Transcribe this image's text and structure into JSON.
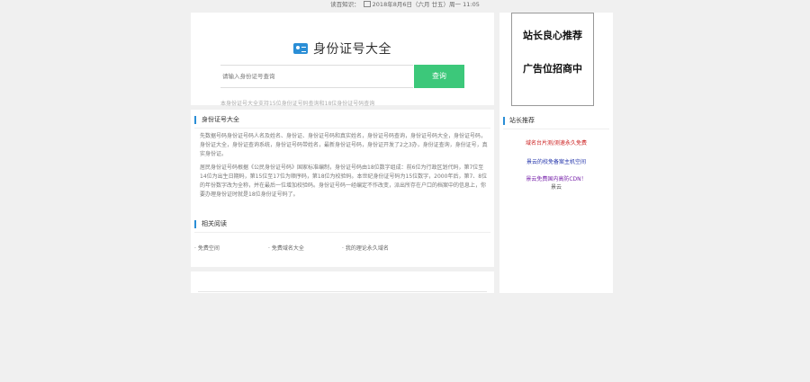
{
  "topbar": {
    "prefix": "读百知识：",
    "date": "2018年8月6日（六月 廿五）周一 11:05"
  },
  "search": {
    "title": "身份证号大全",
    "placeholder": "请输入身份证号查询",
    "button": "查询",
    "note": "本身份证号大全支持15位身份证号码查询和18位身份证号码查询"
  },
  "article": {
    "section_title": "身份证号大全",
    "para1": "先数据号码身份证号码人名及姓名、身份证、身份证号码和真实姓名，身份证号码查询，身份证号码大全，身份证号码，身份证大全，身份证查询系统，身份证号码带姓名，最新身份证号码，身份证开发了2之3办，身份证查询，身份证号，真实身份证。",
    "para2": "居民身份证号码根据《公民身份证号码》国家标准编制，身份证号码由18位数字组成：前6位为行政区划代码，第7位至14位为出生日期码，第15位至17位为顺序码，第18位为校验码。本世纪身份证号码为15位数字，2000年后，第7、8位的年份数字改为全称，并在最后一位增加校验码。身份证号码一经编定不作改变，派出所存在户口的档案中的信息上，你要办理身份证时就是18位身份证号码了。",
    "related_title": "相关阅读",
    "related": [
      "免费空间",
      "免费域名大全",
      "我的理论永久域名"
    ]
  },
  "sidebar": {
    "ad_line1": "站长良心推荐",
    "ad_line2": "广告位招商中",
    "section_title": "站长推荐",
    "links": [
      {
        "text": "域名台片测/测速永久免费",
        "color": "#cc2222"
      },
      {
        "text": "景云的校免备案主机空间",
        "color": "#2233aa"
      },
      {
        "text": "景云免费国内高防CDN！",
        "color": "#7722aa"
      },
      {
        "text": "景云",
        "color": "#555555"
      }
    ]
  },
  "colors": {
    "accent": "#2a8ed6",
    "button": "#3cc87a"
  }
}
